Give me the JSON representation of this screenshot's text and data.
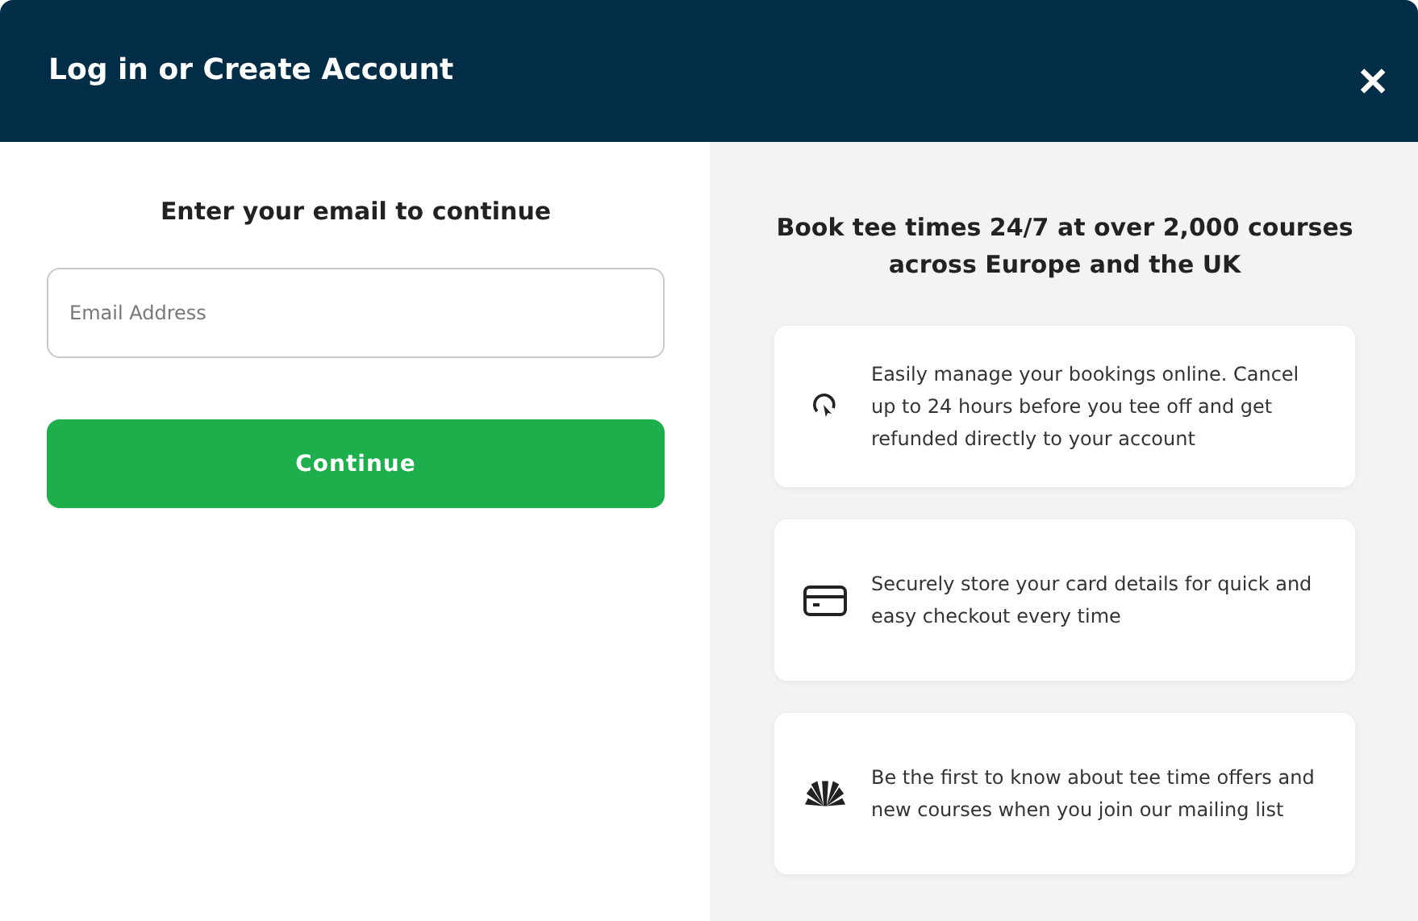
{
  "window": {
    "title": "Log in or Create Account",
    "close": "✕"
  },
  "login": {
    "heading": "Enter your email to continue",
    "email": {
      "placeholder": "Email Address"
    },
    "button": "Continue"
  },
  "benefits": {
    "heading": "Book tee times 24/7 at over 2,000 courses across Europe and the UK",
    "items": [
      {
        "kind": "pointer",
        "text": "Easily manage your bookings online. Cancel up to 24 hours before you tee off and get refunded directly to your account"
      },
      {
        "kind": "card",
        "text": "Securely store your card details for quick and easy checkout every time"
      },
      {
        "kind": "fan",
        "text": "Be the first to know about tee time offers and new courses when you join our mailing list"
      }
    ]
  }
}
